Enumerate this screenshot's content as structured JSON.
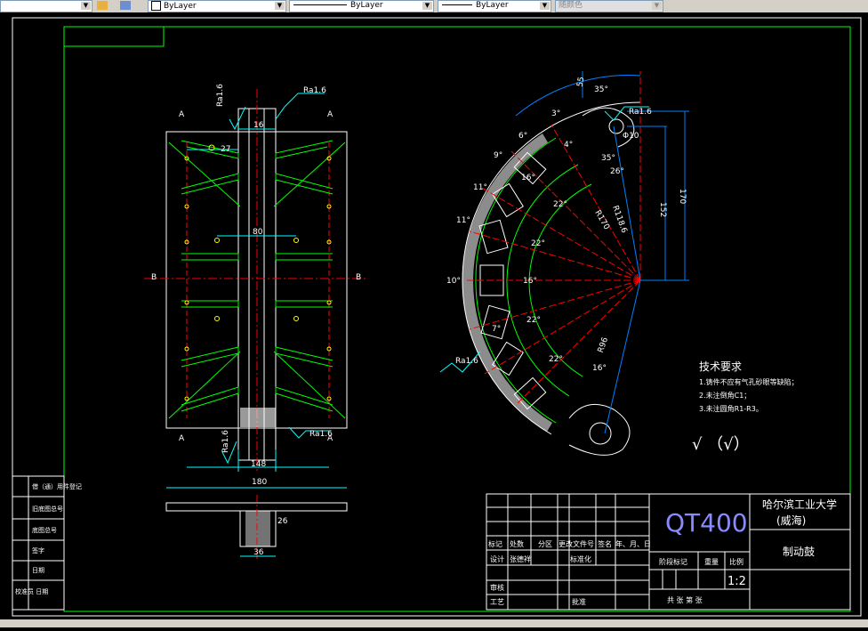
{
  "toolbar": {
    "color_select": "ByLayer",
    "linetype_select": "ByLayer",
    "lineweight_select": "ByLayer",
    "plotstyle_select": "随颜色"
  },
  "drawing": {
    "tech_title": "技术要求",
    "tech_items": [
      "1.铸件不应有气孔砂眼等缺陷；",
      "2.未注倒角C1；",
      "3.未注圆角R1-R3。"
    ],
    "roughness_symbols": "√ （√）",
    "roughness_labels": [
      "Ra1.6",
      "Ra1.6",
      "Ra1.6",
      "Ra1.6",
      "Ra1.6",
      "Ra1.6",
      "Ra1.6"
    ],
    "dims": {
      "d16": "16",
      "d27": "27",
      "d80": "80",
      "d148": "148",
      "d180": "180",
      "d26": "26",
      "d36": "36",
      "r55": "55",
      "a35": "35°",
      "a3": "3°",
      "a6": "6°",
      "a9": "9°",
      "r10": "Φ10",
      "a35b": "35°",
      "r26": "26°",
      "r170": "R170",
      "r118": "R118.6",
      "r162": "152",
      "r170b": "170",
      "a22a": "22°",
      "a22b": "22°",
      "a22c": "22°",
      "a22d": "22°",
      "a11a": "11°",
      "a11b": "11°",
      "a16a": "16°",
      "a16b": "16°",
      "a16c": "16°",
      "a10": "10°",
      "a7": "7°",
      "r96": "R96",
      "a4": "4°"
    },
    "section_labels": [
      "A",
      "A",
      "B",
      "B",
      "A",
      "A"
    ]
  },
  "title_block": {
    "material": "QT400",
    "school": "哈尔滨工业大学",
    "campus": "(威海)",
    "part_name": "制动鼓",
    "row_labels": [
      "标记",
      "处数",
      "分区",
      "更改文件号",
      "签名",
      "年、月、日"
    ],
    "design": "设计",
    "designer": "张德祥",
    "standard": "标准化",
    "stage": "阶段标记",
    "weight": "重量",
    "scale_label": "比例",
    "scale": "1:2",
    "audit": "审核",
    "craft": "工艺",
    "approve": "批准",
    "sheets": "共   张  第   张"
  },
  "left_block": {
    "items": [
      "借（通）用件登记",
      "旧底图总号",
      "底图总号",
      "签字",
      "日期",
      "校准员 日期"
    ]
  }
}
